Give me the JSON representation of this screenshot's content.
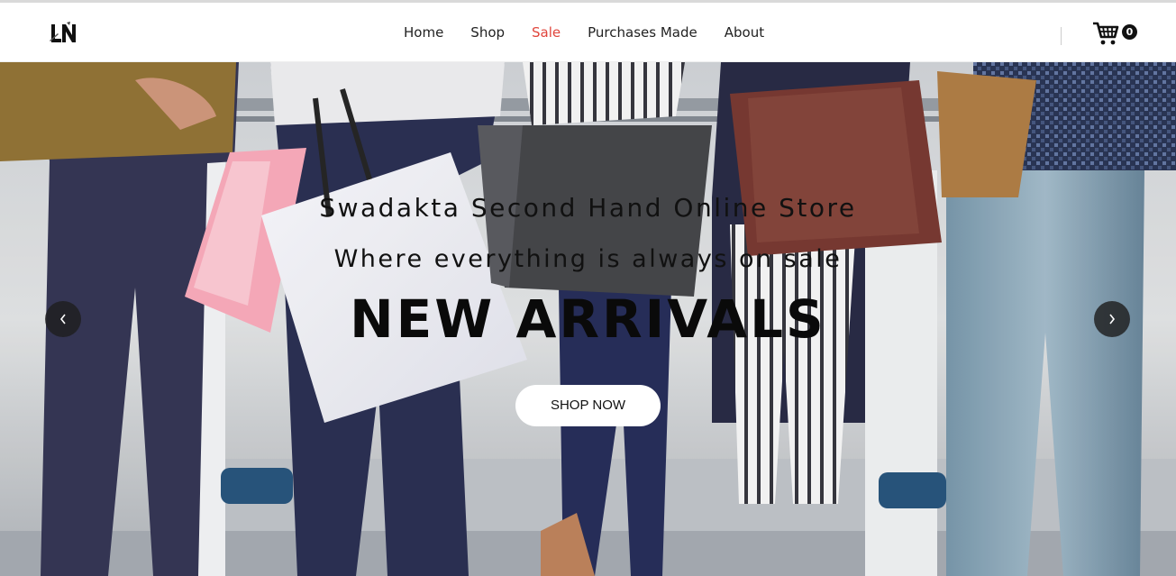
{
  "header": {
    "logo_text": "LN",
    "nav": [
      "Home",
      "Shop",
      "Sale",
      "Purchases Made",
      "About"
    ],
    "active_item": "Sale",
    "cart_count": "0"
  },
  "hero": {
    "line1": "Swadakta Second Hand Online Store",
    "line2": "Where everything is always on sale",
    "title": "NEW ARRIVALS",
    "button_label": "SHOP NOW",
    "prev_icon": "chevron-left-icon",
    "next_icon": "chevron-right-icon"
  },
  "colors": {
    "active_nav": "#e0453c",
    "text": "#222222",
    "button_bg": "#ffffff"
  }
}
